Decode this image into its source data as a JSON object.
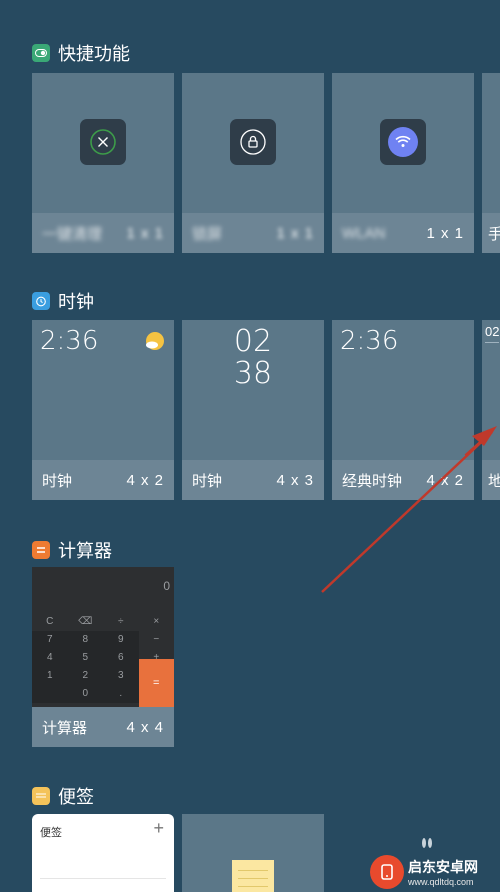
{
  "sections": {
    "quick": {
      "title": "快捷功能",
      "tiles": [
        {
          "name": "一键清理",
          "size": "1 x 1"
        },
        {
          "name": "锁屏",
          "size": "1 x 1"
        },
        {
          "name": "WLAN",
          "size": "1 x 1"
        },
        {
          "name": "手",
          "size": ""
        }
      ]
    },
    "clock": {
      "title": "时钟",
      "tiles": [
        {
          "name": "时钟",
          "size": "4 x 2",
          "time": "2:36"
        },
        {
          "name": "时钟",
          "size": "4 x 3",
          "hour": "02",
          "minute": "38"
        },
        {
          "name": "经典时钟",
          "size": "4 x 2",
          "time": "2:36"
        },
        {
          "name": "地",
          "size": "",
          "time": "02"
        }
      ]
    },
    "calculator": {
      "title": "计算器",
      "tile": {
        "name": "计算器",
        "size": "4 x 4",
        "display": "0"
      },
      "keys": [
        "C",
        "⌫",
        "÷",
        "×",
        "7",
        "8",
        "9",
        "−",
        "4",
        "5",
        "6",
        "+",
        "1",
        "2",
        "3",
        "",
        "",
        "0",
        ".",
        ""
      ],
      "equals": "="
    },
    "notes": {
      "title": "便签",
      "tile": {
        "header": "便签",
        "add": "+"
      }
    }
  },
  "watermark": {
    "site": "启东安卓网",
    "url": "www.qdltdq.com"
  },
  "colors": {
    "background": "#274a60",
    "tile": "#5b7788",
    "label_bar": "#6d8595",
    "accent_orange": "#e8713d",
    "arrow": "#c0392b"
  }
}
